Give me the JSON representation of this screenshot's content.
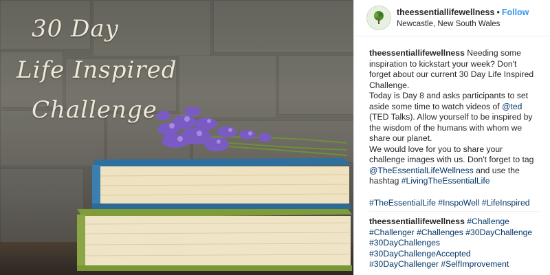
{
  "image": {
    "title_lines": [
      "30 Day",
      "Life Inspired",
      "Challenge"
    ]
  },
  "header": {
    "username": "theessentiallifewellness",
    "separator": "•",
    "follow_label": "Follow",
    "location": "Newcastle, New South Wales"
  },
  "caption": {
    "username": "theessentiallifewellness",
    "p1": "Needing some inspiration to kickstart your week? Don't forget about our current 30 Day Life Inspired Challenge.",
    "p2_a": "Today is Day 8 and asks participants to set aside some time to watch videos of ",
    "p2_mention": "@ted",
    "p2_b": " (TED Talks). Allow yourself to be inspired by the wisdom of the humans with whom we share our planet.",
    "p3_a": "We would love for you to share your challenge images with us. Don't forget to tag ",
    "p3_mention": "@TheEssentialLifeWellness",
    "p3_b": " and use the hashtag ",
    "p3_tag": "#LivingTheEssentialLife",
    "tags": [
      "#TheEssentialLife",
      "#InspoWell",
      "#LifeInspired"
    ]
  },
  "comment": {
    "username": "theessentiallifewellness",
    "tags": [
      "#Challenge",
      "#Challenger",
      "#Challenges",
      "#30DayChallenge",
      "#30DayChallenges",
      "#30DayChallengeAccepted",
      "#30DayChallenger",
      "#SelfImprovement"
    ]
  }
}
